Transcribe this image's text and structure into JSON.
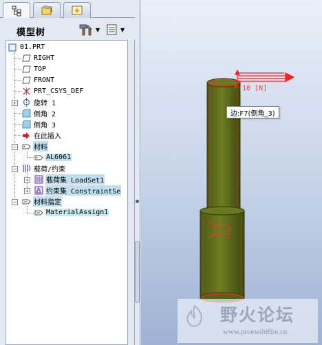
{
  "tabs": [
    {
      "name": "model-tree",
      "icon": "tree-icon",
      "active": true
    },
    {
      "name": "layers",
      "icon": "folder-icon",
      "active": false
    },
    {
      "name": "favorites",
      "icon": "star-icon",
      "active": false
    }
  ],
  "tree_header": {
    "title": "模型树",
    "tools_icon": "hammer-icon",
    "display_icon": "list-settings-icon"
  },
  "tree": {
    "root": "01.PRT",
    "datum_planes": [
      "RIGHT",
      "TOP",
      "FRONT"
    ],
    "csys": "PRT_CSYS_DEF",
    "revolve": "旋转 1",
    "round_2": "倒角 2",
    "round_3": "倒角 3",
    "insert_here": "在此插入",
    "materials": "材料",
    "material_item": "AL6061",
    "loads_constraints": "载荷/约束",
    "load_set": "载荷集 LoadSet1",
    "constraint_set": "约束集 ConstraintSe",
    "material_assign": "材料指定",
    "material_assign_item": "MaterialAssign1"
  },
  "viewport": {
    "load_label": "F:10 [N]",
    "tooltip": "边:F7(倒角_3)"
  },
  "colors": {
    "body_fill": "#5d6a1c",
    "highlight_red": "#ff3030",
    "tree_highlight": "#bfe0f0"
  },
  "watermark": {
    "title": "野火论坛",
    "url": "www.proewildfire.cn"
  }
}
